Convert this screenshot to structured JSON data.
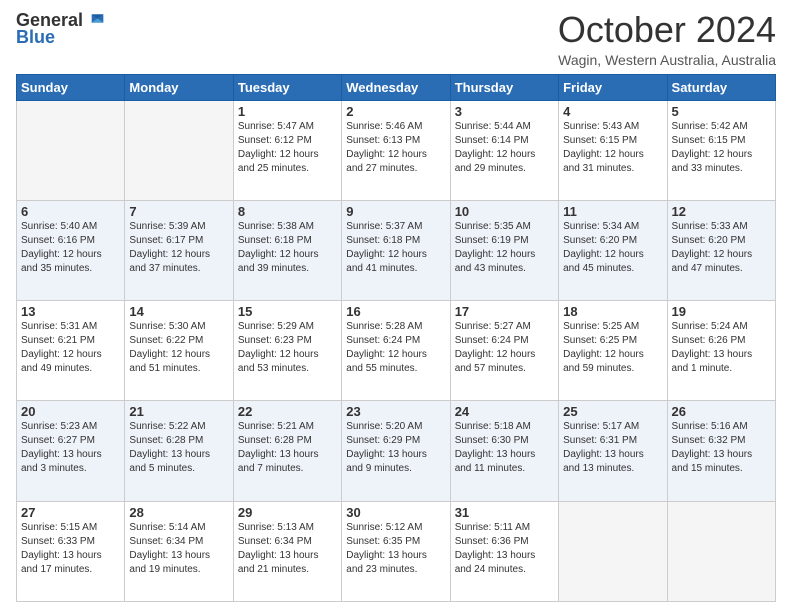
{
  "logo": {
    "general": "General",
    "blue": "Blue"
  },
  "header": {
    "month": "October 2024",
    "location": "Wagin, Western Australia, Australia"
  },
  "days": [
    "Sunday",
    "Monday",
    "Tuesday",
    "Wednesday",
    "Thursday",
    "Friday",
    "Saturday"
  ],
  "weeks": [
    [
      {
        "day": null
      },
      {
        "day": null
      },
      {
        "day": 1,
        "sunrise": "5:47 AM",
        "sunset": "6:12 PM",
        "daylight": "12 hours and 25 minutes."
      },
      {
        "day": 2,
        "sunrise": "5:46 AM",
        "sunset": "6:13 PM",
        "daylight": "12 hours and 27 minutes."
      },
      {
        "day": 3,
        "sunrise": "5:44 AM",
        "sunset": "6:14 PM",
        "daylight": "12 hours and 29 minutes."
      },
      {
        "day": 4,
        "sunrise": "5:43 AM",
        "sunset": "6:15 PM",
        "daylight": "12 hours and 31 minutes."
      },
      {
        "day": 5,
        "sunrise": "5:42 AM",
        "sunset": "6:15 PM",
        "daylight": "12 hours and 33 minutes."
      }
    ],
    [
      {
        "day": 6,
        "sunrise": "5:40 AM",
        "sunset": "6:16 PM",
        "daylight": "12 hours and 35 minutes."
      },
      {
        "day": 7,
        "sunrise": "5:39 AM",
        "sunset": "6:17 PM",
        "daylight": "12 hours and 37 minutes."
      },
      {
        "day": 8,
        "sunrise": "5:38 AM",
        "sunset": "6:18 PM",
        "daylight": "12 hours and 39 minutes."
      },
      {
        "day": 9,
        "sunrise": "5:37 AM",
        "sunset": "6:18 PM",
        "daylight": "12 hours and 41 minutes."
      },
      {
        "day": 10,
        "sunrise": "5:35 AM",
        "sunset": "6:19 PM",
        "daylight": "12 hours and 43 minutes."
      },
      {
        "day": 11,
        "sunrise": "5:34 AM",
        "sunset": "6:20 PM",
        "daylight": "12 hours and 45 minutes."
      },
      {
        "day": 12,
        "sunrise": "5:33 AM",
        "sunset": "6:20 PM",
        "daylight": "12 hours and 47 minutes."
      }
    ],
    [
      {
        "day": 13,
        "sunrise": "5:31 AM",
        "sunset": "6:21 PM",
        "daylight": "12 hours and 49 minutes."
      },
      {
        "day": 14,
        "sunrise": "5:30 AM",
        "sunset": "6:22 PM",
        "daylight": "12 hours and 51 minutes."
      },
      {
        "day": 15,
        "sunrise": "5:29 AM",
        "sunset": "6:23 PM",
        "daylight": "12 hours and 53 minutes."
      },
      {
        "day": 16,
        "sunrise": "5:28 AM",
        "sunset": "6:24 PM",
        "daylight": "12 hours and 55 minutes."
      },
      {
        "day": 17,
        "sunrise": "5:27 AM",
        "sunset": "6:24 PM",
        "daylight": "12 hours and 57 minutes."
      },
      {
        "day": 18,
        "sunrise": "5:25 AM",
        "sunset": "6:25 PM",
        "daylight": "12 hours and 59 minutes."
      },
      {
        "day": 19,
        "sunrise": "5:24 AM",
        "sunset": "6:26 PM",
        "daylight": "13 hours and 1 minute."
      }
    ],
    [
      {
        "day": 20,
        "sunrise": "5:23 AM",
        "sunset": "6:27 PM",
        "daylight": "13 hours and 3 minutes."
      },
      {
        "day": 21,
        "sunrise": "5:22 AM",
        "sunset": "6:28 PM",
        "daylight": "13 hours and 5 minutes."
      },
      {
        "day": 22,
        "sunrise": "5:21 AM",
        "sunset": "6:28 PM",
        "daylight": "13 hours and 7 minutes."
      },
      {
        "day": 23,
        "sunrise": "5:20 AM",
        "sunset": "6:29 PM",
        "daylight": "13 hours and 9 minutes."
      },
      {
        "day": 24,
        "sunrise": "5:18 AM",
        "sunset": "6:30 PM",
        "daylight": "13 hours and 11 minutes."
      },
      {
        "day": 25,
        "sunrise": "5:17 AM",
        "sunset": "6:31 PM",
        "daylight": "13 hours and 13 minutes."
      },
      {
        "day": 26,
        "sunrise": "5:16 AM",
        "sunset": "6:32 PM",
        "daylight": "13 hours and 15 minutes."
      }
    ],
    [
      {
        "day": 27,
        "sunrise": "5:15 AM",
        "sunset": "6:33 PM",
        "daylight": "13 hours and 17 minutes."
      },
      {
        "day": 28,
        "sunrise": "5:14 AM",
        "sunset": "6:34 PM",
        "daylight": "13 hours and 19 minutes."
      },
      {
        "day": 29,
        "sunrise": "5:13 AM",
        "sunset": "6:34 PM",
        "daylight": "13 hours and 21 minutes."
      },
      {
        "day": 30,
        "sunrise": "5:12 AM",
        "sunset": "6:35 PM",
        "daylight": "13 hours and 23 minutes."
      },
      {
        "day": 31,
        "sunrise": "5:11 AM",
        "sunset": "6:36 PM",
        "daylight": "13 hours and 24 minutes."
      },
      {
        "day": null
      },
      {
        "day": null
      }
    ]
  ]
}
